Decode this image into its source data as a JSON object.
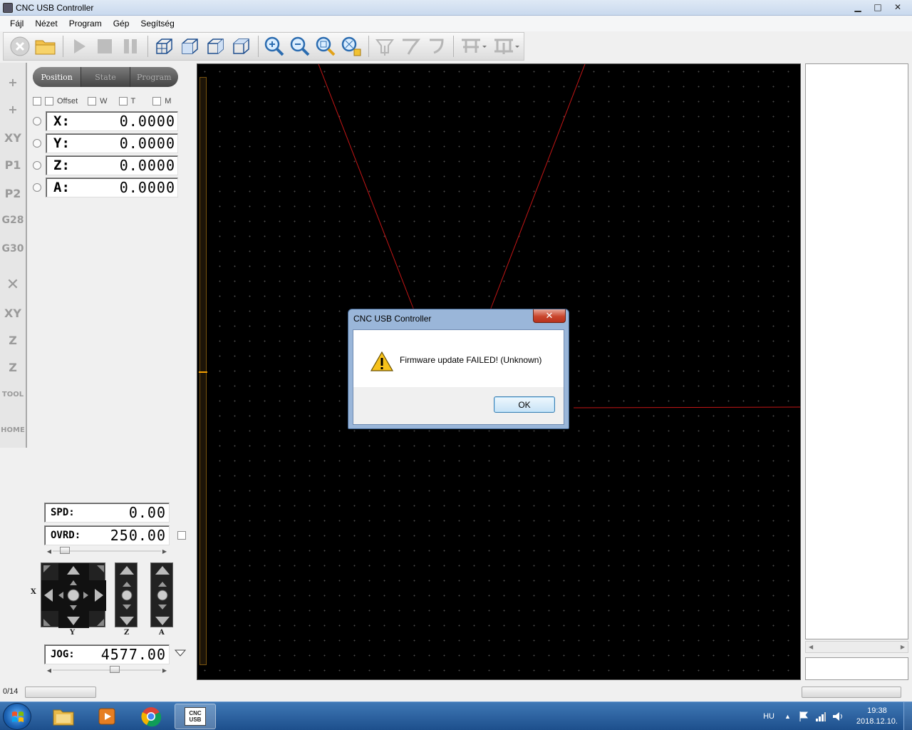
{
  "window": {
    "title": "CNC USB Controller",
    "controls": {
      "minimize": "▭",
      "maximize": "□",
      "close": "✕"
    }
  },
  "menu": [
    "Fájl",
    "Nézet",
    "Program",
    "Gép",
    "Segítség"
  ],
  "toolbar": {
    "icons": [
      "stop-icon",
      "open-folder-icon",
      "play-icon",
      "stop-square-icon",
      "pause-icon",
      "view-3d-icon",
      "view-front-icon",
      "view-side-icon",
      "view-top-icon",
      "zoom-in-icon",
      "zoom-out-icon",
      "zoom-fit-icon",
      "zoom-extents-icon",
      "tool-1-icon",
      "tool-2-icon",
      "tool-3-icon",
      "machine-1-icon",
      "machine-2-icon"
    ]
  },
  "icon_strip": [
    "+",
    "+",
    "XY",
    "P1",
    "P2",
    "G28",
    "G30",
    "✕",
    "XY",
    "Z",
    "Z",
    "TOOL",
    "HOME"
  ],
  "tabs": [
    "Position",
    "State",
    "Program"
  ],
  "active_tab": "Position",
  "checkboxes": [
    {
      "label": "",
      "checked": false
    },
    {
      "label": "Offset",
      "checked": false
    },
    {
      "label": "W",
      "checked": false
    },
    {
      "label": "T",
      "checked": false
    },
    {
      "label": "M",
      "checked": false
    }
  ],
  "dro": [
    {
      "axis": "X:",
      "value": "0.0000"
    },
    {
      "axis": "Y:",
      "value": "0.0000"
    },
    {
      "axis": "Z:",
      "value": "0.0000"
    },
    {
      "axis": "A:",
      "value": "0.0000"
    }
  ],
  "speed": {
    "spd_label": "SPD:",
    "spd_value": "0.00",
    "ovrd_label": "OVRD:",
    "ovrd_value": "250.00",
    "jog_label": "JOG:",
    "jog_value": "4577.00"
  },
  "jog_axis_labels": {
    "x": "X",
    "y": "Y",
    "z": "Z",
    "a": "A"
  },
  "status": {
    "progress_text": "0/14"
  },
  "dialog": {
    "title": "CNC USB Controller",
    "close": "✕",
    "message": "Firmware update FAILED! (Unknown)",
    "ok": "OK"
  },
  "taskbar": {
    "language": "HU",
    "time": "19:38",
    "date": "2018.12.10.",
    "app_label": "CNC USB"
  },
  "colors": {
    "viewport_bg": "#000000",
    "toolpath": "#d01818",
    "z_indicator": "#f5a000",
    "taskbar": "#2a5d9e"
  }
}
